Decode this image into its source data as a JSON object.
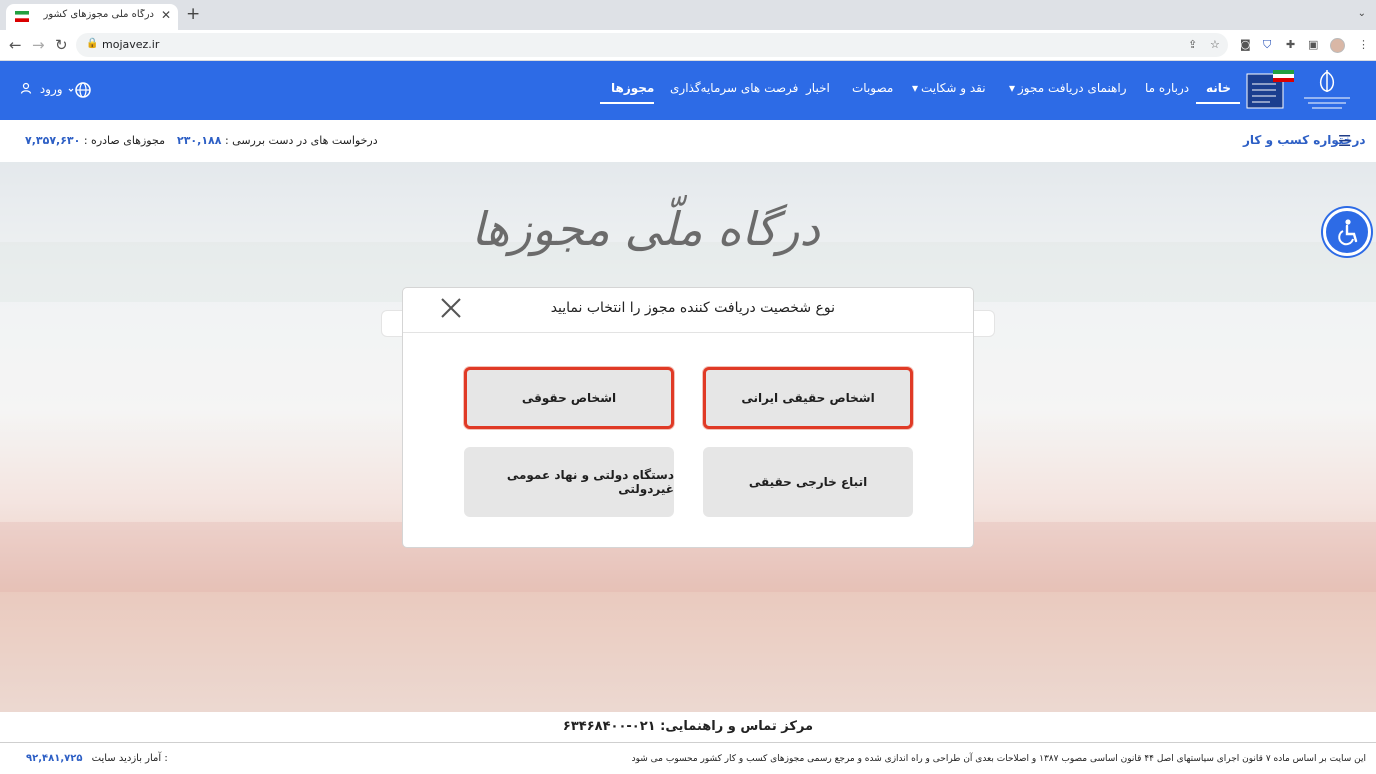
{
  "browser": {
    "tab_title": "درگاه ملی مجوزهای کشور",
    "tab_close": "✕",
    "new_tab": "+",
    "url": "mojavez.ir"
  },
  "header": {
    "nav": {
      "home": "خانه",
      "about": "درباره ما",
      "guide": "راهنمای دریافت مجوز",
      "complaints": "نقد و شکایت",
      "approvals": "مصوبات",
      "news": "اخبار",
      "investment": "فرصت های سرمایه‌گذاری",
      "licenses": "مجوزها"
    },
    "login": "ورود"
  },
  "stats": {
    "biz_request": "درختواره کسب و کار",
    "pending_label": "درخواست های در دست بررسی :",
    "pending_value": "۲۳۰,۱۸۸",
    "issued_label": "مجوزهای صادره :",
    "issued_value": "۷,۳۵۷,۶۳۰"
  },
  "hero": {
    "title": "درگاه ملّی مجوزها"
  },
  "modal": {
    "title": "نوع شخصیت دریافت کننده مجوز را انتخاب نمایید",
    "options": {
      "iranian_person": "اشخاص حقیقی ایرانی",
      "legal_person": "اشخاص حقوقی",
      "foreign_person": "اتباع خارجی حقیقی",
      "government": "دستگاه دولتی و نهاد عمومی غیردولتی"
    }
  },
  "footer": {
    "contact": "مرکز تماس و راهنمایی: ۰۲۱-۶۳۴۶۸۴۰۰",
    "legal": "این سایت بر اساس ماده ۷ قانون اجرای سیاستهای اصل ۴۴ قانون اساسی مصوب ۱۳۸۷ و اصلاحات بعدی آن طراحی و راه اندازی شده و مرجع رسمی مجوزهای کسب و کار کشور محسوب می شود",
    "visits_label": "آمار بازدید سایت :",
    "visits_value": "۹۲,۴۸۱,۷۲۵"
  },
  "colors": {
    "header_blue": "#2d6be6",
    "highlight_red": "#e03a26",
    "number_blue": "#2d5fc5"
  }
}
